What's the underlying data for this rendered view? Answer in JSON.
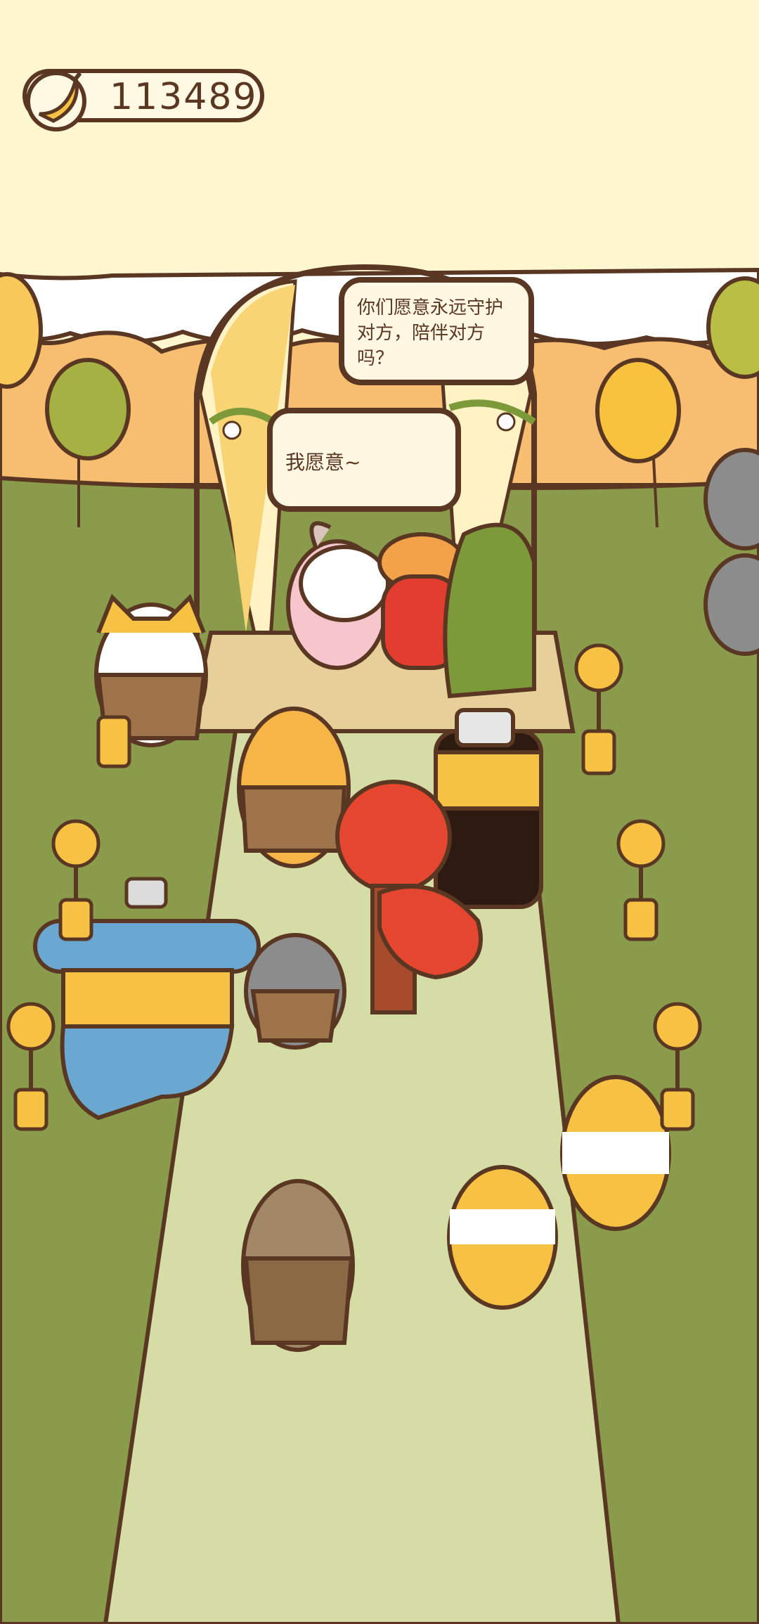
{
  "hud": {
    "coin_count": "113489",
    "coin_icon": "banana-icon"
  },
  "dialogue": {
    "priest_line": "你们愿意永远守护对方，陪伴对方吗？",
    "couple_reply": "我愿意~"
  },
  "colors": {
    "sky": "#fdf6cf",
    "grass": "#8a9b4c",
    "aisle": "#d6dca6",
    "outline": "#5a3722",
    "hills": "#f7bd71",
    "bubble_fill": "#fff7e2"
  }
}
